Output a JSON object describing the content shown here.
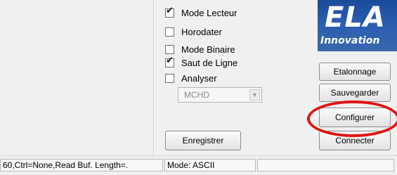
{
  "options": {
    "mode_lecteur": {
      "label": "Mode Lecteur",
      "checked": true
    },
    "horodater": {
      "label": "Horodater",
      "checked": false
    },
    "mode_binaire": {
      "label": "Mode Binaire",
      "checked": false
    },
    "saut_de_ligne": {
      "label": "Saut de Ligne",
      "checked": true
    },
    "analyser": {
      "label": "Analyser",
      "checked": false
    },
    "protocol_select": {
      "value": "MCHD"
    }
  },
  "buttons": {
    "etalonnage": "Etalonnage",
    "sauvegarder": "Sauvegarder",
    "configurer": "Configurer",
    "connecter": "Connecter",
    "enregistrer": "Enregistrer"
  },
  "logo": {
    "top": "ELA",
    "bottom": "Innovation"
  },
  "statusbar": {
    "connection_info": "60,Ctrl=None,Read Buf. Length=.",
    "mode": "Mode: ASCII",
    "extra": ""
  },
  "colors": {
    "highlight_circle": "#e01414",
    "logo_background": "#2a5db0"
  }
}
